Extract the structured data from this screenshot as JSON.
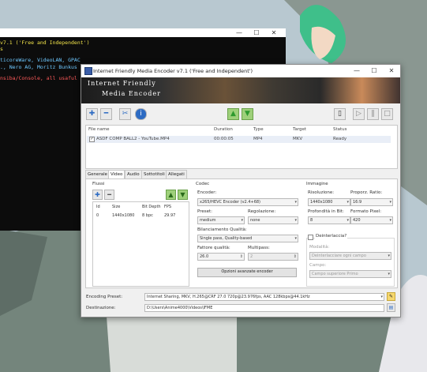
{
  "console": {
    "lines": [
      {
        "text": "v7.1 ('Free and Independent')",
        "color": "#f2e44a"
      },
      {
        "text": "s",
        "color": "#f2e44a"
      },
      {
        "text": "ticoreWare, VideoLAN, GPAC",
        "color": "#6ec8ff"
      },
      {
        "text": "., Nero AG, Moritz Bunkus",
        "color": "#6ec8ff"
      },
      {
        "text": "nsiba/Console, all usaful",
        "color": "#ff5a5a"
      }
    ]
  },
  "window": {
    "title": "Internet Friendly Media Encoder v7.1 ('Free and Independent')",
    "banner_line1": "Internet Friendly",
    "banner_line2": "Media Encoder",
    "controls": {
      "minimize": "—",
      "maximize": "☐",
      "close": "✕"
    }
  },
  "file_list": {
    "headers": {
      "file_name": "File name",
      "duration": "Duration",
      "type": "Type",
      "target": "Target",
      "status": "Status"
    },
    "rows": [
      {
        "file_name": "ASDF COMP BALL2 - YouTube.MP4",
        "duration": "00:00:05",
        "type": "MP4",
        "target": "MKV",
        "status": "Ready",
        "checked": true
      }
    ]
  },
  "tabs": [
    "Generale",
    "Video",
    "Audio",
    "Sottotitoli",
    "Allegati"
  ],
  "active_tab": "Video",
  "flussi": {
    "title": "Flussi",
    "headers": {
      "id": "Id",
      "size": "Size",
      "bit_depth": "Bit Depth",
      "fps": "FPS"
    },
    "rows": [
      {
        "id": "0",
        "size": "1440x1080",
        "bit_depth": "8 bpc",
        "fps": "29.97"
      }
    ]
  },
  "codec": {
    "title": "Codec",
    "encoder_label": "Encoder:",
    "encoder_value": "x265/HEVC Encoder (v2.4+68)",
    "preset_label": "Preset:",
    "preset_value": "medium",
    "tuning_label": "Regolazione:",
    "tuning_value": "none",
    "quality_mode_label": "Bilanciamento Qualità:",
    "quality_mode_value": "Single pass, Quality-based",
    "quality_label": "Fattore qualità:",
    "quality_value": "26.0",
    "multipass_label": "Multipass:",
    "multipass_value": "2",
    "advanced_button": "Opzioni avanzate encoder"
  },
  "image": {
    "title": "Immagine",
    "resolution_label": "Risoluzione:",
    "resolution_value": "1440x1080",
    "aspect_label": "Proporz. Ratio:",
    "aspect_value": "16:9",
    "bitdepth_label": "Profondità in Bit:",
    "bitdepth_value": "8",
    "pixfmt_label": "Formato Pixel:",
    "pixfmt_value": "420",
    "deinterlace_label": "Deinterlaccia?",
    "mode_label": "Modalità:",
    "mode_value": "Deinterlacciare ogni campo",
    "field_label": "Campo:",
    "field_value": "Campo superiore Primo"
  },
  "encoding_preset": {
    "label": "Encoding Preset:",
    "value": "Internet Sharing, MKV, H.265@CRF 27.0 720p@23.976fps, AAC 128kbps@44.1kHz"
  },
  "destination": {
    "label": "Destinazione:",
    "value": "D:\\Users\\Anime4000\\Videos\\IFME"
  }
}
